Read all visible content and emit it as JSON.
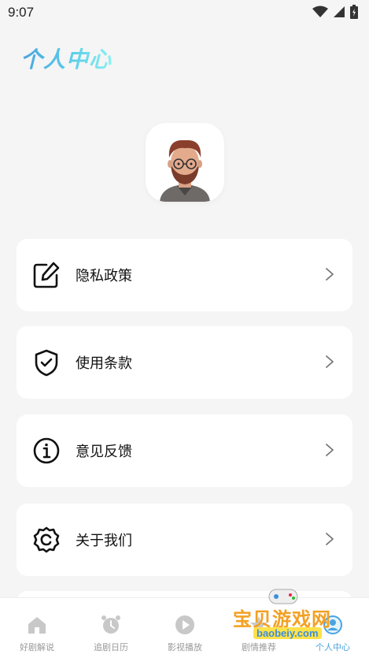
{
  "status_bar": {
    "time": "9:07",
    "icons": [
      "wifi-icon",
      "cell-signal-icon",
      "battery-icon"
    ]
  },
  "header": {
    "title": "个人中心"
  },
  "profile": {
    "avatar": "avatar-illustration"
  },
  "menu": {
    "items": [
      {
        "label": "隐私政策",
        "icon": "edit-icon"
      },
      {
        "label": "使用条款",
        "icon": "shield-check-icon"
      },
      {
        "label": "意见反馈",
        "icon": "info-icon"
      },
      {
        "label": "关于我们",
        "icon": "gear-icon"
      }
    ]
  },
  "tabbar": {
    "tabs": [
      {
        "label": "好剧解说",
        "icon": "home-icon"
      },
      {
        "label": "追剧日历",
        "icon": "alarm-clock-icon"
      },
      {
        "label": "影视播放",
        "icon": "play-icon"
      },
      {
        "label": "剧情推荐",
        "icon": "star-icon"
      },
      {
        "label": "个人中心",
        "icon": "person-icon"
      }
    ],
    "active_index": 4,
    "active_color": "#4aa3e0",
    "inactive_color": "#999999"
  },
  "watermark": {
    "text": "宝贝游戏网",
    "sub": "baobeiy.com"
  },
  "colors": {
    "accent": "#4aa3e0",
    "background": "#f5f5f5",
    "card": "#ffffff"
  }
}
